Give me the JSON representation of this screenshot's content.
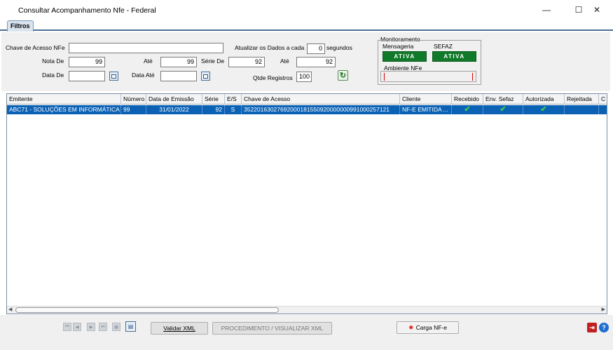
{
  "window": {
    "title": "Consultar Acompanhamento Nfe - Federal",
    "minimize_glyph": "—",
    "maximize_glyph": "☐",
    "close_glyph": "✕"
  },
  "tabs": [
    {
      "label": "Filtros",
      "active": true
    }
  ],
  "filters": {
    "chave_label": "Chave de Acesso NFe",
    "chave_value": "",
    "nota_de_label": "Nota De",
    "nota_de_value": "99",
    "ate1_label": "Até",
    "ate1_value": "99",
    "serie_de_label": "Série De",
    "serie_de_value": "92",
    "ate2_label": "Até",
    "ate2_value": "92",
    "data_de_label": "Data De",
    "data_de_value": "",
    "data_ate_label": "Data Até",
    "data_ate_value": "",
    "atualizar_label": "Atualizar os Dados a cada",
    "atualizar_value": "0",
    "segundos_label": "segundos",
    "qtde_label": "Qtde Registros",
    "qtde_value": "100"
  },
  "monitoramento": {
    "title": "Monitoramento",
    "mensageria_label": "Mensageria",
    "mensageria_status": "ATIVA",
    "sefaz_label": "SEFAZ",
    "sefaz_status": "ATIVA",
    "ambiente_label": "Ambiente NFe",
    "status_color": "#117a2a"
  },
  "grid": {
    "columns": [
      "Emitente",
      "Número",
      "Data de Emissão",
      "Série",
      "E/S",
      "Chave de Acesso",
      "Cliente",
      "Recebido",
      "Env. Sefaz",
      "Autorizada",
      "Rejeitada",
      "C"
    ],
    "rows": [
      {
        "emitente": "ABC71 - SOLUÇÕES EM INFORMÁTICA",
        "numero": "99",
        "data_emissao": "31/01/2022",
        "serie": "92",
        "es": "S",
        "chave": "35220163027692000181550920000000991000257121",
        "cliente": "NF-E EMITIDA ...",
        "recebido": true,
        "env_sefaz": true,
        "autorizada": true,
        "rejeitada": false,
        "selected": true
      }
    ],
    "selection_color": "#0b62b5"
  },
  "footer": {
    "validar_xml": "Validar XML",
    "procedimento": "PROCEDIMENTO / VISUALIZAR XML",
    "carga_nfe": "Carga NF-e"
  },
  "icons": {
    "check": "✔",
    "nav": [
      "first-icon",
      "prev-icon",
      "next-icon",
      "last-icon",
      "grid-icon",
      "export-icon"
    ],
    "refresh": "refresh-icon",
    "exit": "exit-icon",
    "help": "help-icon"
  }
}
